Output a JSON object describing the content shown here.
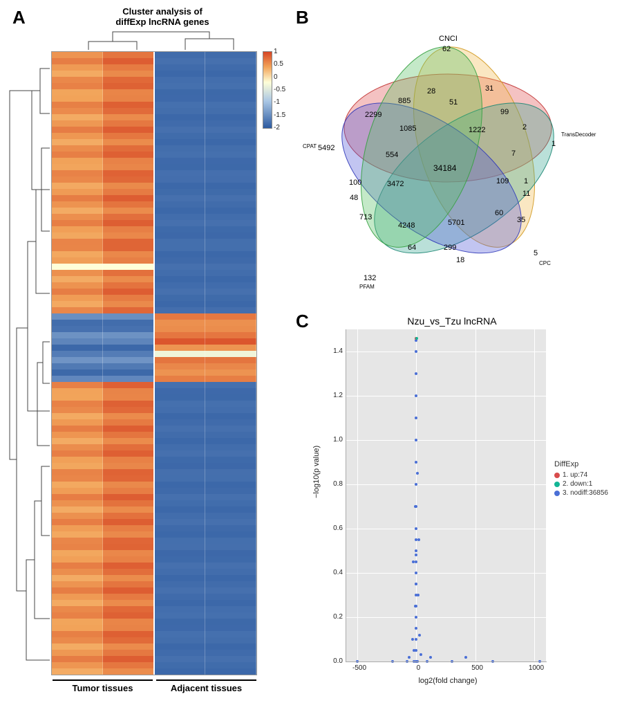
{
  "panelA": {
    "label": "A",
    "title": "Cluster analysis of\ndiffExp lncRNA genes",
    "groups": [
      "Tumor tissues",
      "Adjacent tissues"
    ],
    "colorbar_ticks": [
      "1",
      "0.5",
      "0",
      "-0.5",
      "-1",
      "-1.5",
      "-2"
    ]
  },
  "panelB": {
    "label": "B",
    "venn_sets": {
      "CNCI": "CNCI",
      "TransDecoder": "TransDecoder",
      "CPC": "CPC",
      "PFAM": "PFAM",
      "CPAT": "CPAT"
    },
    "venn_numbers": {
      "CNCI_only": "62",
      "TransDecoder_only": "1",
      "CPC_only": "5",
      "PFAM_only": "132",
      "CPAT_only": "5492",
      "center": "34184",
      "n2299": "2299",
      "n885": "885",
      "n28": "28",
      "n51": "51",
      "n31": "31",
      "n99": "99",
      "n1085": "1085",
      "n1222": "1222",
      "n2": "2",
      "n554": "554",
      "n7": "7",
      "n100": "100",
      "n3472": "3472",
      "n109": "109",
      "n1": "1",
      "n11": "11",
      "n48": "48",
      "n713": "713",
      "n4248": "4248",
      "n5701": "5701",
      "n60": "60",
      "n35": "35",
      "n64": "64",
      "n299": "299",
      "n18": "18"
    }
  },
  "panelC": {
    "label": "C",
    "title": "Nzu_vs_Tzu lncRNA",
    "xlabel": "log2(fold change)",
    "ylabel": "−log10(p value)",
    "legend_title": "DiffExp",
    "legend": [
      {
        "label": "1. up:74",
        "color": "#d84c4c"
      },
      {
        "label": "2. down:1",
        "color": "#13b595"
      },
      {
        "label": "3. nodiff:36856",
        "color": "#4a6fd6"
      }
    ],
    "xticks": [
      "-500",
      "0",
      "500",
      "1000"
    ],
    "yticks": [
      "0.0",
      "0.2",
      "0.4",
      "0.6",
      "0.8",
      "1.0",
      "1.2",
      "1.4"
    ]
  },
  "chart_data": [
    {
      "type": "heatmap",
      "title": "Cluster analysis of diffExp lncRNA genes",
      "col_groups": [
        "Tumor tissues",
        "Tumor tissues",
        "Adjacent tissues",
        "Adjacent tissues"
      ],
      "zlim": [
        -2,
        1
      ],
      "n_rows": 100,
      "note": "Row-scaled expression of differentially expressed lncRNA genes. Tumor columns predominantly high (~0.5 to 1), adjacent columns predominantly low (~-1.5 to -2), a small band of rows around the middle shows the inverse pattern.",
      "colorbar": {
        "low": "#2c5aa0",
        "mid": "#fefed8",
        "high": "#d64524"
      }
    },
    {
      "type": "venn5",
      "sets": [
        "CNCI",
        "TransDecoder",
        "CPC",
        "PFAM",
        "CPAT"
      ],
      "regions": {
        "CNCI": 62,
        "TransDecoder": 1,
        "CPC": 5,
        "PFAM": 132,
        "CPAT": 5492,
        "all5": 34184,
        "CPAT&CNCI": 2299,
        "CPAT&CNCI&PFAM": 885,
        "CNCI&PFAM": 28,
        "CNCI&TransDecoder&PFAM": 51,
        "CNCI&TransDecoder": 31,
        "CNCI&TransDecoder&CPC": 99,
        "CPAT&CNCI&PFAM&CPC": 1085,
        "CNCI&TransDecoder&PFAM&CPC": 1222,
        "TransDecoder&CPC": 2,
        "CPAT&CNCI&CPC": 554,
        "TransDecoder&PFAM&CPC": 7,
        "CPAT&TransDecoder": 100,
        "CPAT&PFAM&CPC": 3472,
        "CNCI&CPC": 109,
        "TransDecoder&PFAM": 1,
        "TransDecoder&CPC&PFAM?": 11,
        "CPAT&PFAM": 48,
        "CPAT&CPC": 713,
        "CPAT&PFAM&CPC&?": 4248,
        "PFAM&CPC&?": 5701,
        "CPC&?": 60,
        "CPC&TransDecoder?": 35,
        "PFAM&?": 64,
        "PFAM&CPC": 299,
        "?": 18
      }
    },
    {
      "type": "scatter",
      "title": "Nzu_vs_Tzu lncRNA",
      "xlabel": "log2(fold change)",
      "ylabel": "-log10(p value)",
      "xlim": [
        -600,
        1100
      ],
      "ylim": [
        0,
        1.5
      ],
      "series": [
        {
          "name": "nodiff (36856)",
          "color": "#4a6fd6",
          "points_sample": [
            [
              -500,
              0
            ],
            [
              -200,
              0
            ],
            [
              -80,
              0
            ],
            [
              -20,
              0
            ],
            [
              -5,
              0
            ],
            [
              0,
              0
            ],
            [
              10,
              0
            ],
            [
              90,
              0
            ],
            [
              300,
              0
            ],
            [
              650,
              0
            ],
            [
              1050,
              0
            ],
            [
              0,
              0.05
            ],
            [
              0,
              0.1
            ],
            [
              0,
              0.15
            ],
            [
              0,
              0.2
            ],
            [
              0,
              0.25
            ],
            [
              0,
              0.3
            ],
            [
              0,
              0.35
            ],
            [
              0,
              0.4
            ],
            [
              0,
              0.45
            ],
            [
              0,
              0.5
            ],
            [
              0,
              0.55
            ],
            [
              0,
              0.6
            ],
            [
              0,
              0.7
            ],
            [
              0,
              0.8
            ],
            [
              0,
              0.9
            ],
            [
              0,
              1.0
            ],
            [
              0,
              1.1
            ],
            [
              0,
              1.2
            ],
            [
              0,
              1.3
            ],
            [
              0,
              1.4
            ],
            [
              0,
              1.45
            ],
            [
              -30,
              0.1
            ],
            [
              30,
              0.12
            ],
            [
              -10,
              0.25
            ],
            [
              15,
              0.3
            ],
            [
              -25,
              0.45
            ],
            [
              20,
              0.55
            ],
            [
              -18,
              0.05
            ],
            [
              40,
              0.03
            ],
            [
              -10,
              0.7
            ],
            [
              8,
              0.85
            ],
            [
              0,
              0.35
            ],
            [
              0,
              0.48
            ],
            [
              -60,
              0.02
            ],
            [
              120,
              0.02
            ],
            [
              420,
              0.02
            ]
          ]
        },
        {
          "name": "up (74)",
          "color": "#d84c4c",
          "points_sample": [
            [
              -5,
              1.46
            ]
          ]
        },
        {
          "name": "down (1)",
          "color": "#13b595",
          "points_sample": [
            [
              5,
              1.46
            ]
          ]
        }
      ]
    }
  ]
}
